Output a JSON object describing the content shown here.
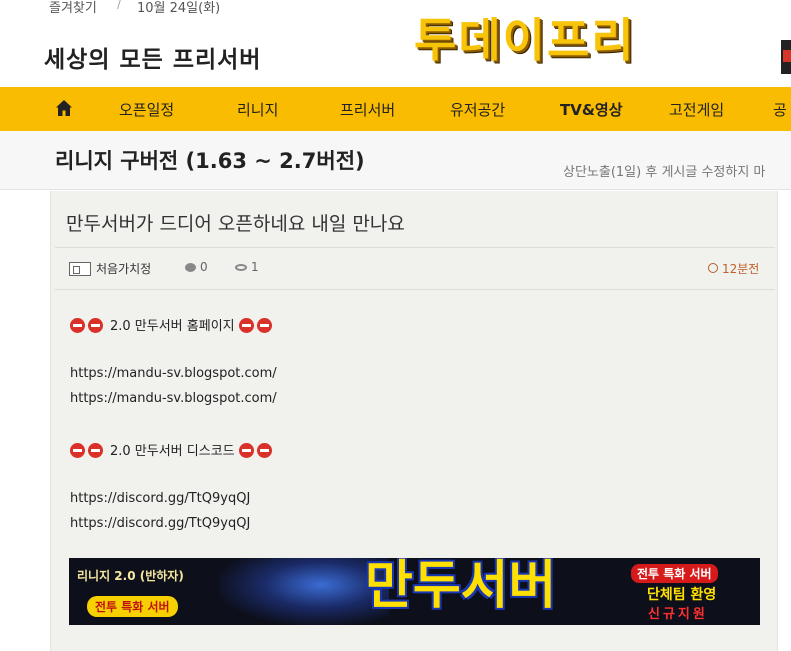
{
  "topbar": {
    "favorites": "즐겨찾기",
    "separator": "/",
    "date": "10월 24일(화)"
  },
  "header": {
    "site_name": "세상의 모든 프리서버",
    "logo_text": "투데이프리"
  },
  "nav": {
    "home_icon": "home-icon",
    "items": [
      "오픈일정",
      "리니지",
      "프리서버",
      "유저공간",
      "TV&영상",
      "고전게임",
      "공"
    ]
  },
  "titlebar": {
    "title": "리니지 구버전 (1.63 ~ 2.7버전)",
    "notice": "상단노출(1일) 후 게시글 수정하지 마"
  },
  "post": {
    "title": "만두서버가 드디어 오픈하네요 내일 만나요",
    "author": "처음가치정",
    "comments": "0",
    "views": "1",
    "time": "12분전",
    "homepage_heading": "2.0 만두서버 홈페이지",
    "homepage_url_1": "https://mandu-sv.blogspot.com/",
    "homepage_url_2": "https://mandu-sv.blogspot.com/",
    "discord_heading": "2.0 만두서버 디스코드",
    "discord_url_1": "https://discord.gg/TtQ9yqQJ",
    "discord_url_2": "https://discord.gg/TtQ9yqQJ"
  },
  "banner": {
    "left_top": "리니지 2.0 (반하자)",
    "left_pill": "전투 특화 서버",
    "main": "만두서버",
    "right_1": "전투 특화 서버",
    "right_2": "단체팀 환영",
    "right_3": "신규지원"
  },
  "colors": {
    "nav_bg": "#f9bc00",
    "logo": "#f7c40a",
    "time": "#c0602a",
    "card_bg": "#f1f1ee"
  }
}
